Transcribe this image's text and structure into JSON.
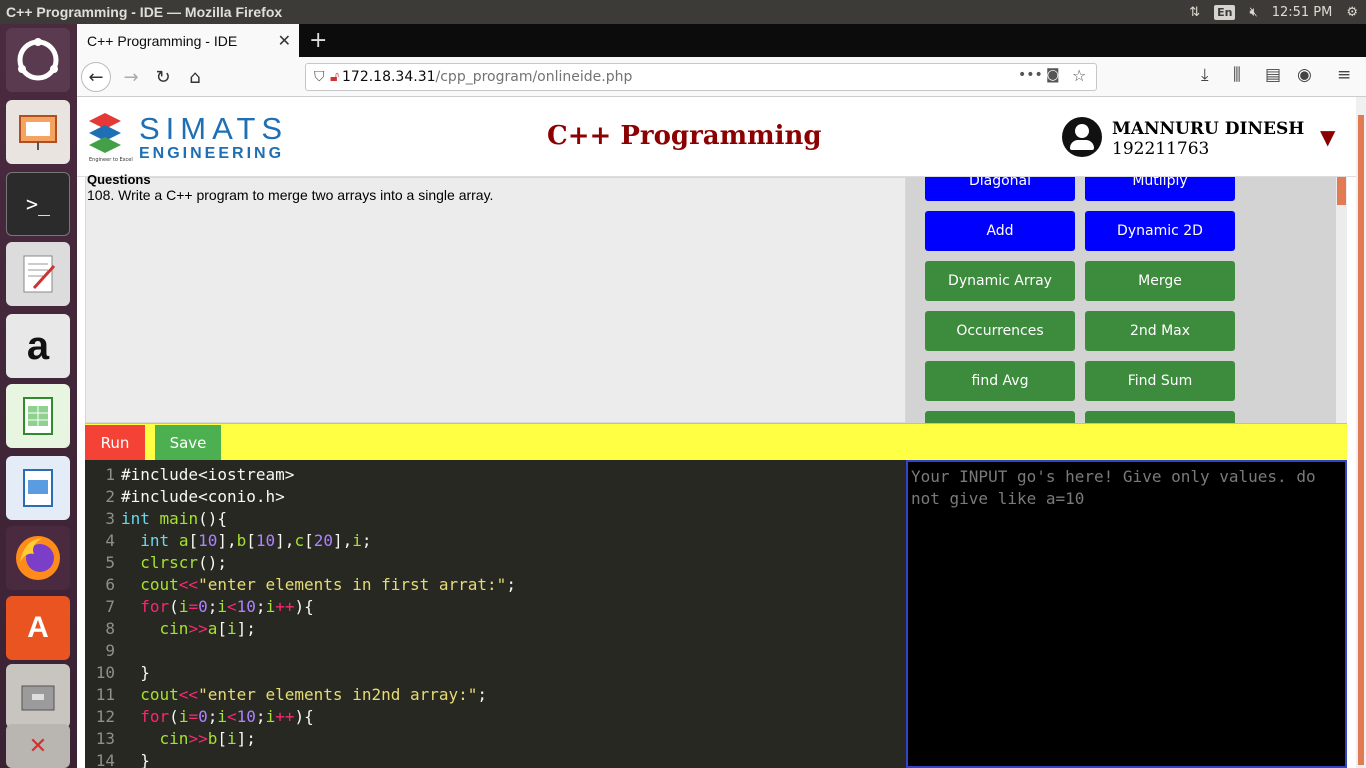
{
  "os": {
    "window_title": "C++ Programming - IDE — Mozilla Firefox",
    "lang": "En",
    "clock": "12:51 PM"
  },
  "browser": {
    "tab_title": "C++ Programming - IDE",
    "url_host": "172.18.34.31",
    "url_path": "/cpp_program/onlineide.php"
  },
  "header": {
    "logo_main": "SIMATS",
    "logo_sub": "ENGINEERING",
    "logo_tag": "Engineer to Excel",
    "title": "C++ Programming",
    "user_name": "MANNURU DINESH",
    "user_id": "192211763",
    "dropdown_glyph": "▼"
  },
  "questions": {
    "heading": "Questions",
    "text": "108. Write a C++ program to merge two arrays into a single array."
  },
  "program_buttons": [
    {
      "label": "Diagonal",
      "color": "#0000ff"
    },
    {
      "label": "Mutliply",
      "color": "#0000ff"
    },
    {
      "label": "Add",
      "color": "#0000ff"
    },
    {
      "label": "Dynamic 2D",
      "color": "#0000ff"
    },
    {
      "label": "Dynamic Array",
      "color": "#3d8b3d"
    },
    {
      "label": "Merge",
      "color": "#3d8b3d"
    },
    {
      "label": "Occurrences",
      "color": "#3d8b3d"
    },
    {
      "label": "2nd Max",
      "color": "#3d8b3d"
    },
    {
      "label": "find Avg",
      "color": "#3d8b3d"
    },
    {
      "label": "Find Sum",
      "color": "#3d8b3d"
    }
  ],
  "toolbar": {
    "run_label": "Run",
    "save_label": "Save"
  },
  "editor": {
    "line_numbers": [
      "1",
      "2",
      "3",
      "4",
      "5",
      "6",
      "7",
      "8",
      "9",
      "10",
      "11",
      "12",
      "13",
      "14"
    ]
  },
  "input": {
    "placeholder": "Your INPUT go's here! Give only values. do not give like a=10"
  }
}
